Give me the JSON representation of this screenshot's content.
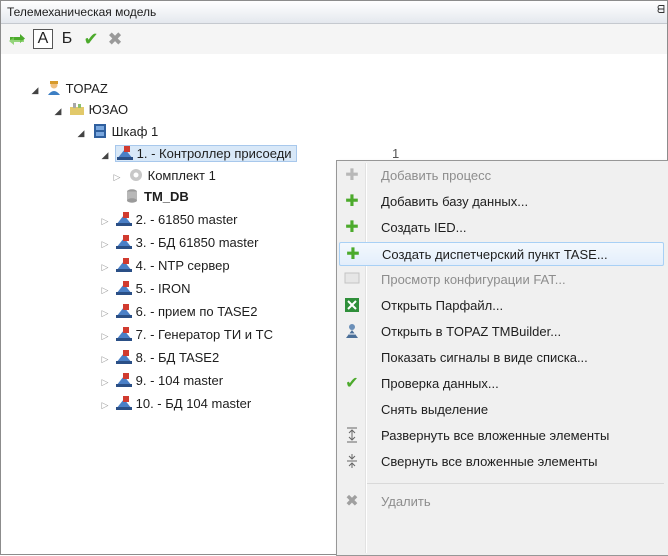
{
  "panel": {
    "title": "Телемеханическая модель",
    "pin": "ᗺ"
  },
  "toolbar": {
    "refresh": "⇄",
    "sort_a": "А",
    "sort_b": "Б",
    "check": "✔",
    "remove": "✖"
  },
  "tree": {
    "root": "TOPAZ",
    "region": "ЮЗАО",
    "cabinet": "Шкаф 1",
    "selected": "1. - Контроллер присоеди",
    "selected_tail": "1",
    "kit": "Комплект 1",
    "db": "TM_DB",
    "items": [
      "2. - 61850 master",
      "3. - БД 61850 master",
      "4. - NTP сервер",
      "5. - IRON",
      "6. - прием по TASE2",
      "7. - Генератор ТИ и ТС",
      "8. - БД TASE2",
      "9. - 104 master",
      "10. - БД 104 master"
    ]
  },
  "menu": {
    "items": [
      {
        "label": "Добавить процесс",
        "icon": "plus-icon",
        "disabled": true
      },
      {
        "label": "Добавить базу данных...",
        "icon": "plus-icon",
        "disabled": false
      },
      {
        "label": "Создать IED...",
        "icon": "plus-icon",
        "disabled": false
      },
      {
        "label": "Создать диспетчерский пункт TASE...",
        "icon": "plus-icon",
        "disabled": false,
        "hover": true
      },
      {
        "label": "Просмотр конфигурации FAT...",
        "icon": "fat-icon",
        "disabled": true
      },
      {
        "label": "Открыть Парфайл...",
        "icon": "excel-icon",
        "disabled": false
      },
      {
        "label": "Открыть в TOPAZ TMBuilder...",
        "icon": "tmbuilder-icon",
        "disabled": false
      },
      {
        "label": "Показать сигналы в виде списка...",
        "icon": "",
        "disabled": false
      },
      {
        "label": "Проверка данных...",
        "icon": "check-icon",
        "disabled": false
      },
      {
        "label": "Снять выделение",
        "icon": "",
        "disabled": false
      },
      {
        "label": "Развернуть все вложенные элементы",
        "icon": "expand-all-icon",
        "disabled": false
      },
      {
        "label": "Свернуть все вложенные элементы",
        "icon": "collapse-all-icon",
        "disabled": false
      },
      {
        "label": "Удалить",
        "icon": "delete-icon",
        "disabled": true
      }
    ]
  },
  "colors": {
    "green": "#4caa2c",
    "gray": "#9a9a9a",
    "select": "#d8e8f8"
  }
}
